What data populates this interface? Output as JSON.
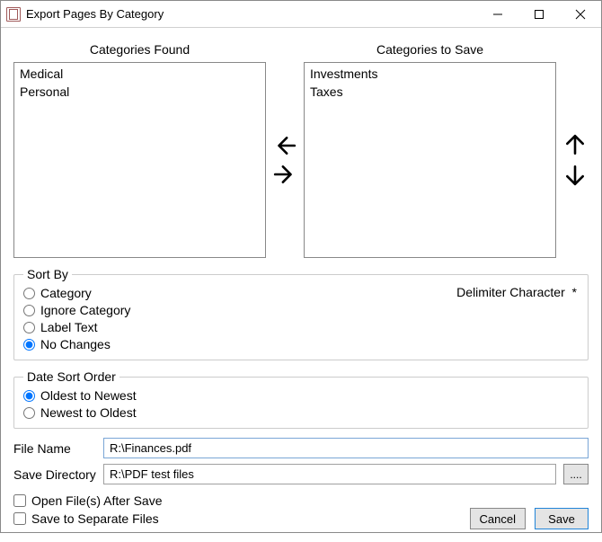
{
  "window": {
    "title": "Export Pages By Category"
  },
  "categories": {
    "found_header": "Categories Found",
    "save_header": "Categories to Save",
    "found": [
      "Medical",
      "Personal"
    ],
    "to_save": [
      "Investments",
      "Taxes"
    ]
  },
  "sort_by": {
    "legend": "Sort By",
    "delimiter_label": "Delimiter Character",
    "delimiter_value": "*",
    "options": {
      "category": "Category",
      "ignore_category": "Ignore Category",
      "label_text": "Label Text",
      "no_changes": "No Changes"
    },
    "selected": "no_changes"
  },
  "date_sort": {
    "legend": "Date Sort Order",
    "options": {
      "oldest": "Oldest to Newest",
      "newest": "Newest to Oldest"
    },
    "selected": "oldest"
  },
  "file_name": {
    "label": "File Name",
    "value": "R:\\Finances.pdf"
  },
  "save_dir": {
    "label": "Save Directory",
    "value": "R:\\PDF test files",
    "browse": "...."
  },
  "checks": {
    "open_after": "Open File(s) After Save",
    "separate": "Save to Separate Files"
  },
  "buttons": {
    "cancel": "Cancel",
    "save": "Save"
  }
}
